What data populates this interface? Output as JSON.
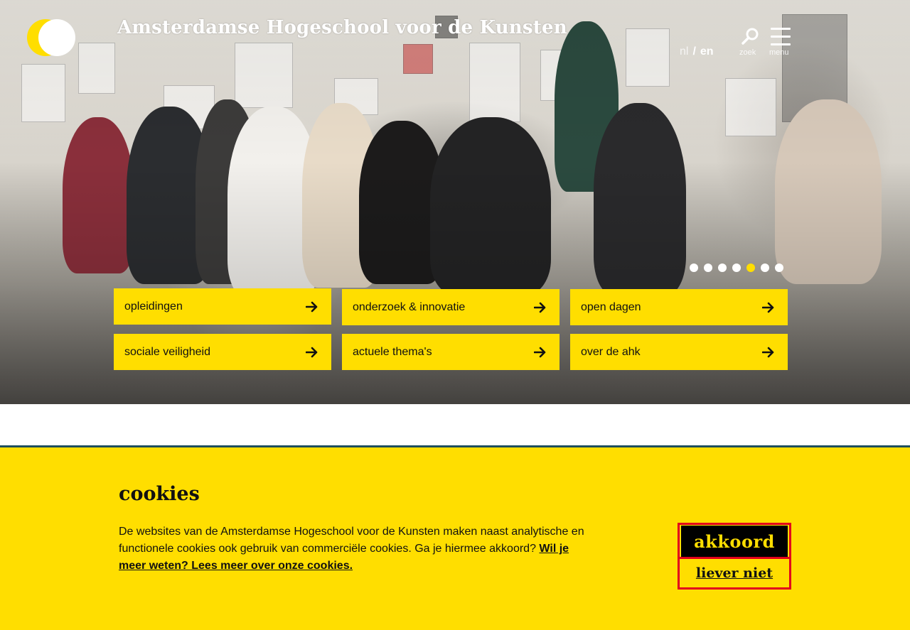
{
  "header": {
    "site_title": "Amsterdamse Hogeschool voor de Kunsten",
    "lang": {
      "nl": "nl",
      "separator": "/",
      "en": "en"
    },
    "search_label": "zoek",
    "menu_label": "menu"
  },
  "hero": {
    "slides_total": 7,
    "active_slide": 5
  },
  "nav_tiles": [
    {
      "label": "opleidingen"
    },
    {
      "label": "onderzoek & innovatie"
    },
    {
      "label": "open dagen"
    },
    {
      "label": "sociale veiligheid"
    },
    {
      "label": "actuele thema's"
    },
    {
      "label": "over de ahk"
    }
  ],
  "cookie": {
    "title": "cookies",
    "text": "De websites van de Amsterdamse Hogeschool voor de Kunsten maken naast analytische en functionele cookies ook gebruik van commerciële cookies. Ga je hiermee akkoord?",
    "link": "Wil je meer weten? Lees meer over onze cookies.",
    "accept": "akkoord",
    "decline": "liever niet"
  },
  "colors": {
    "accent": "#ffde00",
    "divider": "#1f4f5c",
    "focus": "#e3001b"
  }
}
